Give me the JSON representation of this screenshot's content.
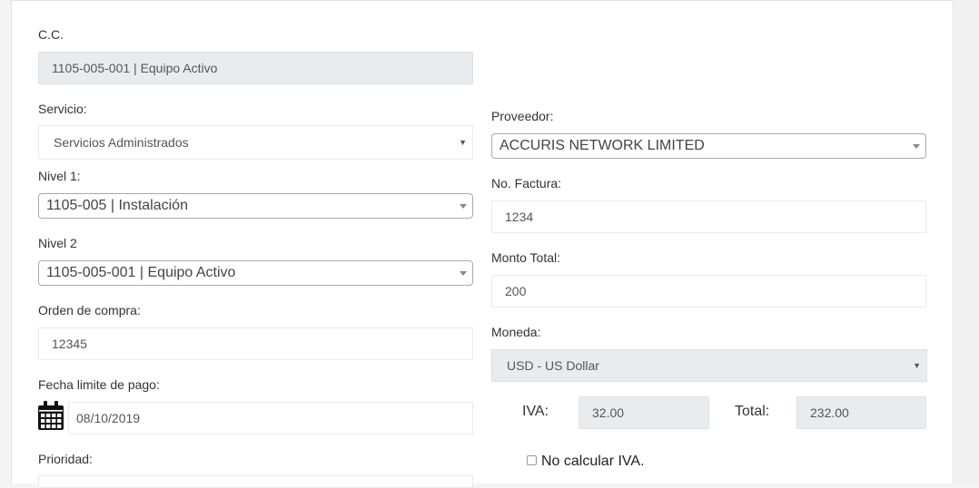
{
  "form": {
    "cc": {
      "label": "C.C.",
      "value": "1105-005-001 | Equipo Activo"
    },
    "servicio": {
      "label": "Servicio:",
      "value": "Servicios Administrados"
    },
    "nivel1": {
      "label": "Nivel 1:",
      "value": "1105-005 | Instalación"
    },
    "nivel2": {
      "label": "Nivel 2",
      "value": "1105-005-001 | Equipo Activo"
    },
    "orden_compra": {
      "label": "Orden de compra:",
      "value": "12345"
    },
    "fecha_limite": {
      "label": "Fecha limite de pago:",
      "value": "08/10/2019"
    },
    "prioridad": {
      "label": "Prioridad:"
    },
    "proveedor": {
      "label": "Proveedor:",
      "value": "ACCURIS NETWORK LIMITED"
    },
    "factura": {
      "label": "No. Factura:",
      "value": "1234"
    },
    "monto_total": {
      "label": "Monto Total:",
      "value": "200"
    },
    "moneda": {
      "label": "Moneda:",
      "value": "USD - US Dollar"
    },
    "iva": {
      "label": "IVA:",
      "value": "32.00"
    },
    "total": {
      "label": "Total:",
      "value": "232.00"
    },
    "no_calcular_iva": {
      "label": "No calcular IVA.",
      "checked": false
    }
  },
  "icons": {
    "calendar": "calendar-icon"
  },
  "colors": {
    "readonly_bg": "#e9ecef",
    "select2_border": "#aaaaaa"
  }
}
